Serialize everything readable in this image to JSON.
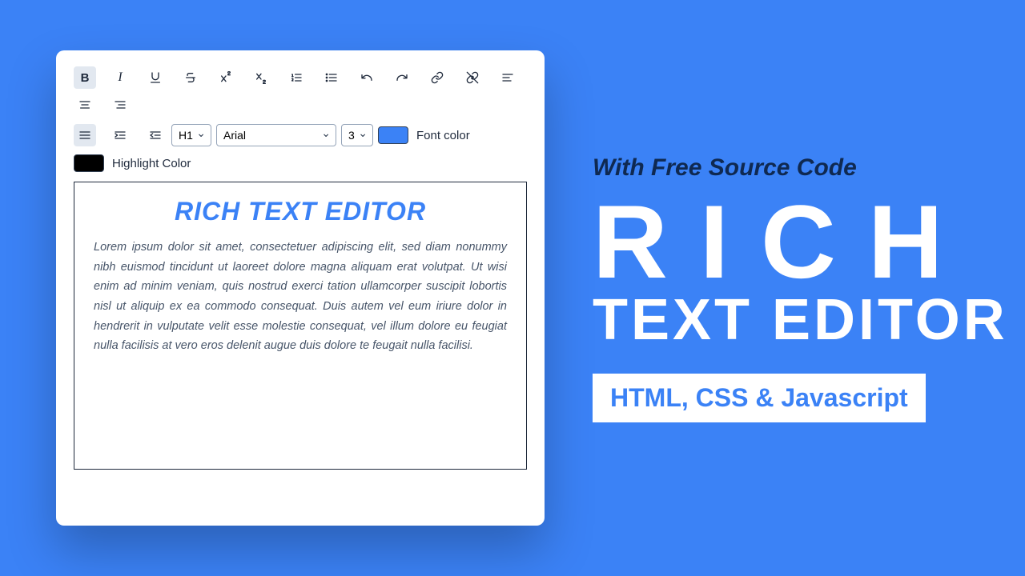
{
  "toolbar": {
    "heading_value": "H1",
    "font_value": "Arial",
    "size_value": "3",
    "font_color_label": "Font color",
    "highlight_color_label": "Highlight Color"
  },
  "content": {
    "heading": "RICH TEXT EDITOR",
    "body": "Lorem ipsum dolor sit amet, consectetuer adipiscing elit, sed diam nonummy nibh euismod tincidunt ut laoreet dolore magna aliquam erat volutpat. Ut wisi enim ad minim veniam, quis nostrud exerci tation ullamcorper suscipit lobortis nisl ut aliquip ex ea commodo consequat. Duis autem vel eum iriure dolor in hendrerit in vulputate velit esse molestie consequat, vel illum dolore eu feugiat nulla facilisis at vero eros delenit augue duis dolore te feugait nulla facilisi."
  },
  "promo": {
    "tagline": "With Free Source Code",
    "title_line1": "RICH",
    "title_line2": "TEXT EDITOR",
    "tech": "HTML, CSS & Javascript"
  },
  "colors": {
    "accent": "#3b82f6",
    "font_swatch": "#3b82f6",
    "highlight_swatch": "#000000"
  }
}
